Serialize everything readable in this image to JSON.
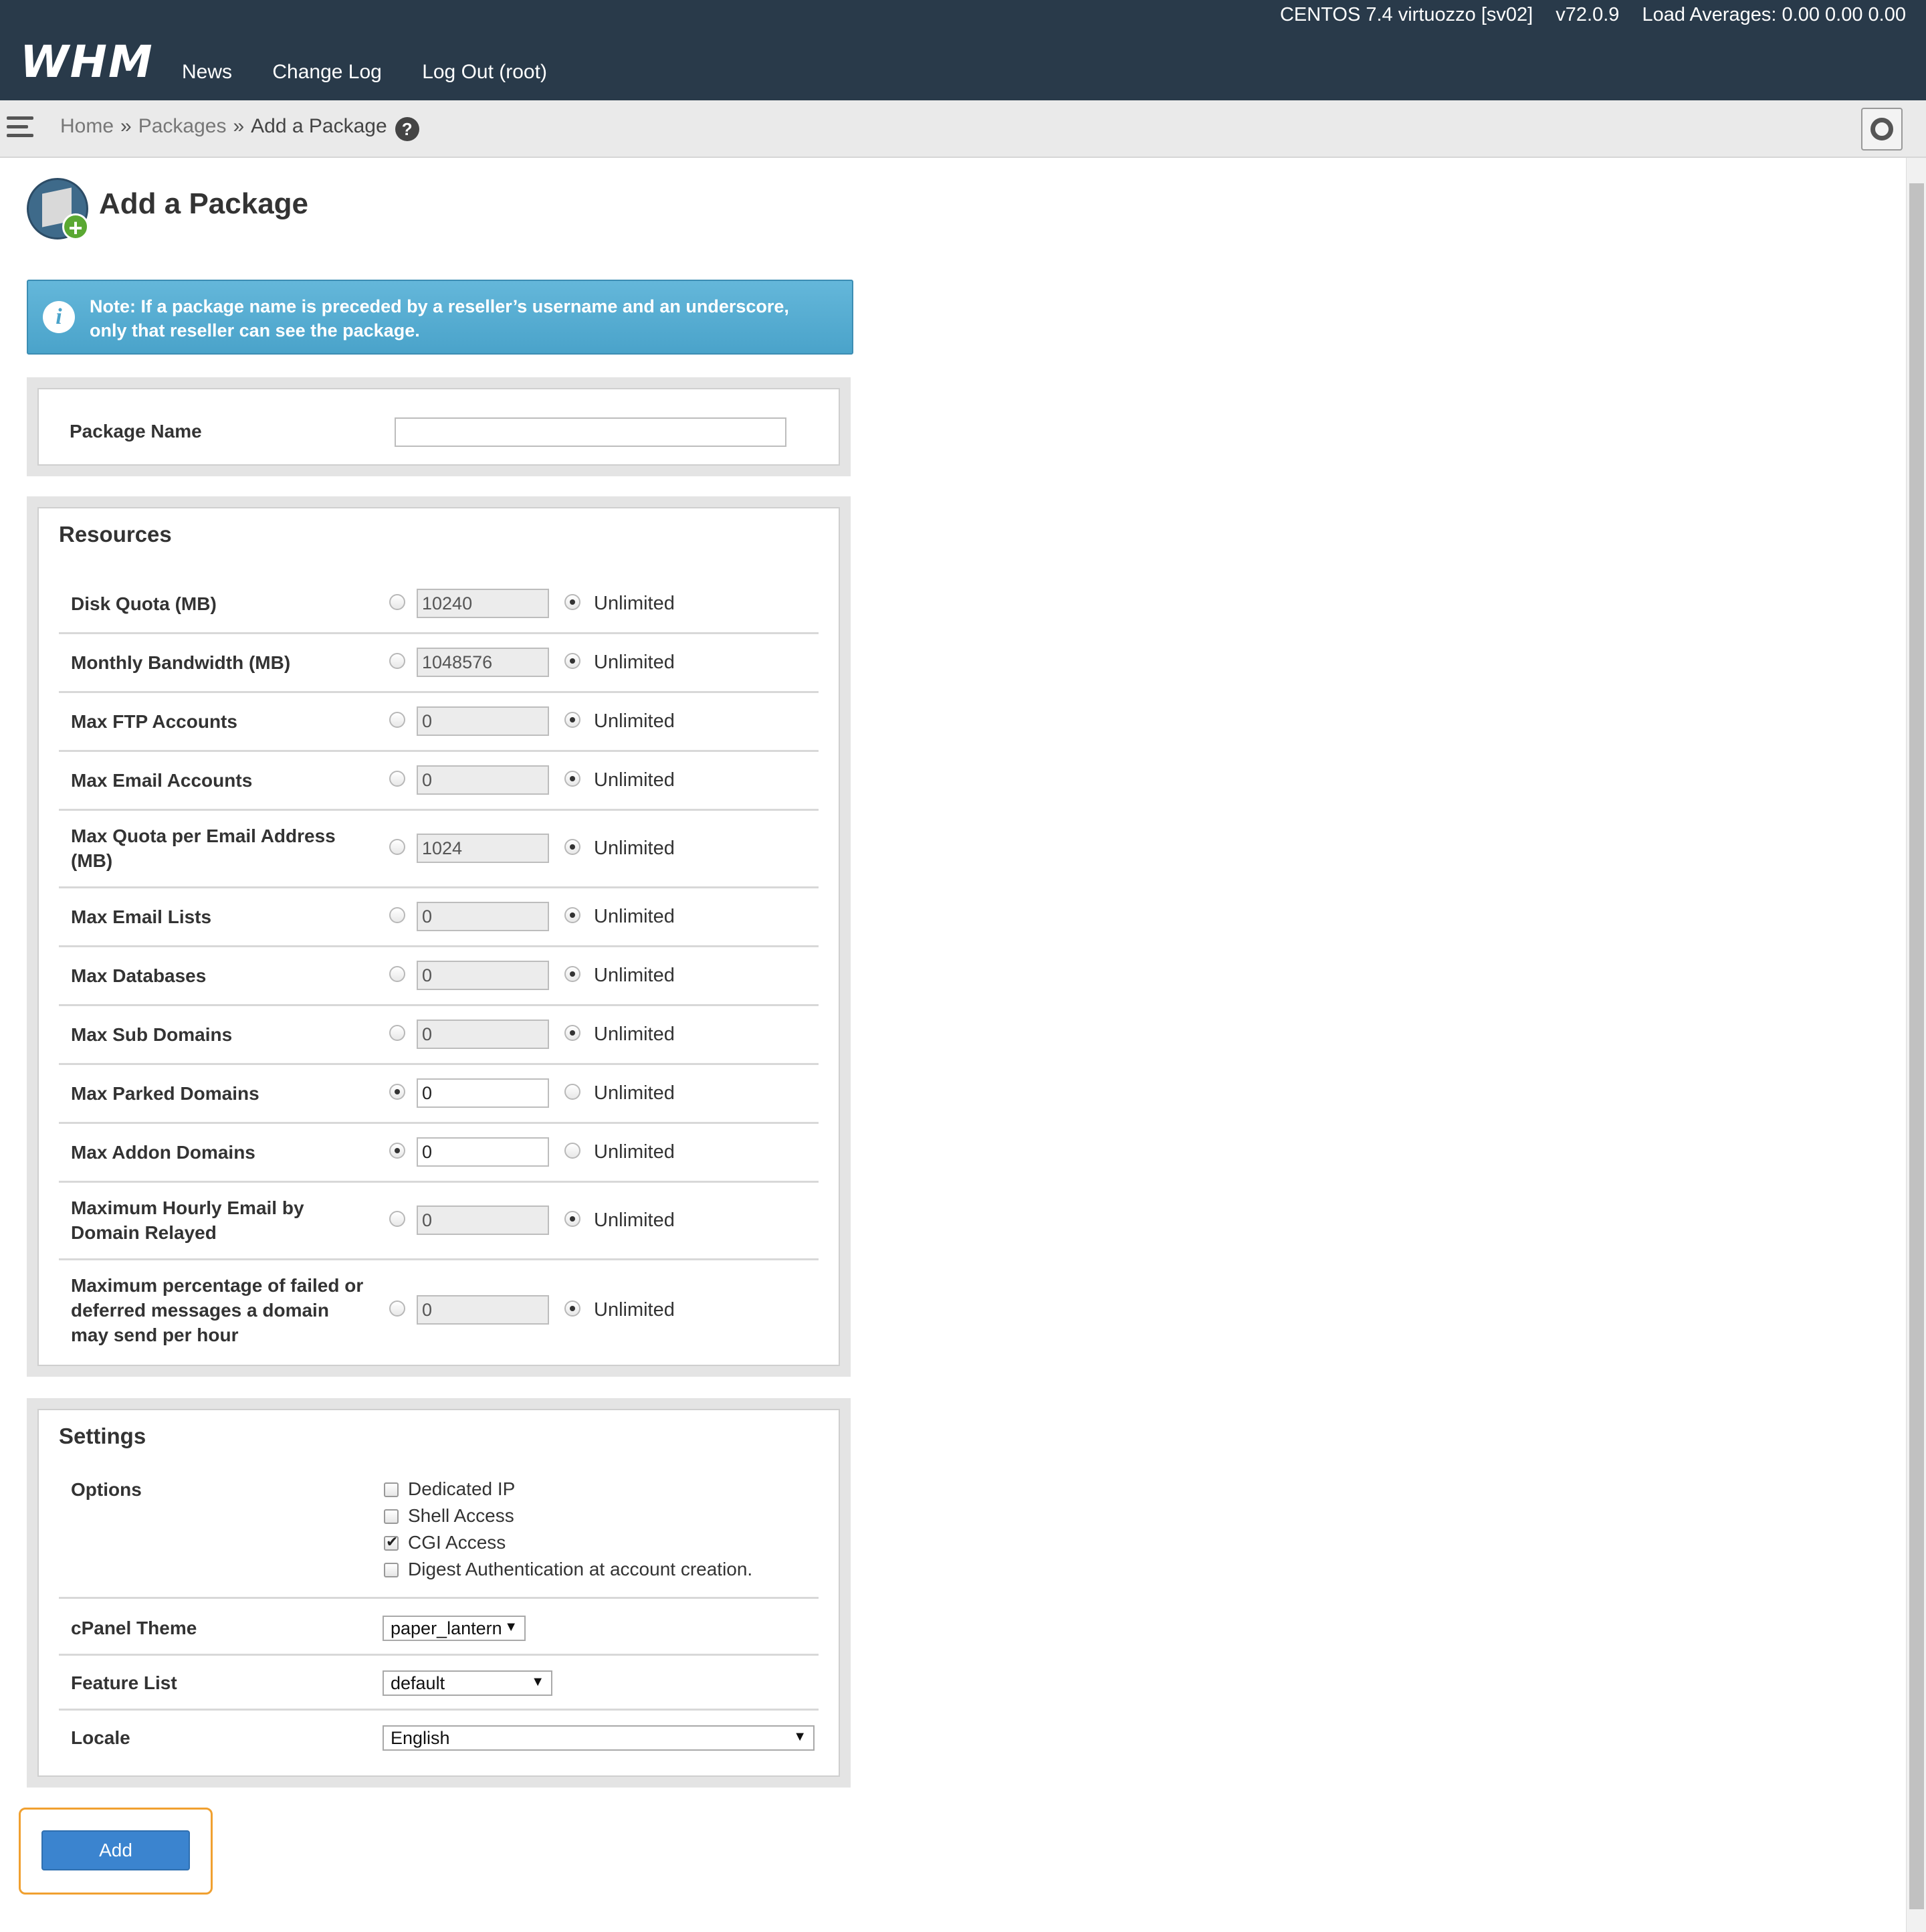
{
  "header": {
    "logo": "WHM",
    "os": "CENTOS 7.4 virtuozzo [sv02]",
    "version": "v72.0.9",
    "load": "Load Averages: 0.00 0.00 0.00",
    "nav": [
      "News",
      "Change Log",
      "Log Out (root)"
    ]
  },
  "breadcrumb": {
    "home": "Home",
    "sep": "»",
    "packages": "Packages",
    "current": "Add a Package",
    "help": "?"
  },
  "page": {
    "title": "Add a Package",
    "note": "Note: If a package name is preceded by a reseller’s username and an underscore, only that reseller can see the package."
  },
  "package_name": {
    "label": "Package Name",
    "value": ""
  },
  "resources": {
    "title": "Resources",
    "unlimited_label": "Unlimited",
    "rows": [
      {
        "label": "Disk Quota (MB)",
        "value": "10240",
        "unlimited": true
      },
      {
        "label": "Monthly Bandwidth (MB)",
        "value": "1048576",
        "unlimited": true
      },
      {
        "label": "Max FTP Accounts",
        "value": "0",
        "unlimited": true
      },
      {
        "label": "Max Email Accounts",
        "value": "0",
        "unlimited": true
      },
      {
        "label": "Max Quota per Email Address (MB)",
        "value": "1024",
        "unlimited": true
      },
      {
        "label": "Max Email Lists",
        "value": "0",
        "unlimited": true
      },
      {
        "label": "Max Databases",
        "value": "0",
        "unlimited": true
      },
      {
        "label": "Max Sub Domains",
        "value": "0",
        "unlimited": true
      },
      {
        "label": "Max Parked Domains",
        "value": "0",
        "unlimited": false
      },
      {
        "label": "Max Addon Domains",
        "value": "0",
        "unlimited": false
      },
      {
        "label": "Maximum Hourly Email by Domain Relayed",
        "value": "0",
        "unlimited": true
      },
      {
        "label": "Maximum percentage of failed or deferred messages a domain may send per hour",
        "value": "0",
        "unlimited": true
      }
    ]
  },
  "settings": {
    "title": "Settings",
    "options_label": "Options",
    "options": [
      {
        "label": "Dedicated IP",
        "checked": false
      },
      {
        "label": "Shell Access",
        "checked": false
      },
      {
        "label": "CGI Access",
        "checked": true
      },
      {
        "label": "Digest Authentication at account creation.",
        "checked": false
      }
    ],
    "theme_label": "cPanel Theme",
    "theme_value": "paper_lantern",
    "feature_label": "Feature List",
    "feature_value": "default",
    "locale_label": "Locale",
    "locale_value": "English"
  },
  "actions": {
    "add": "Add"
  }
}
